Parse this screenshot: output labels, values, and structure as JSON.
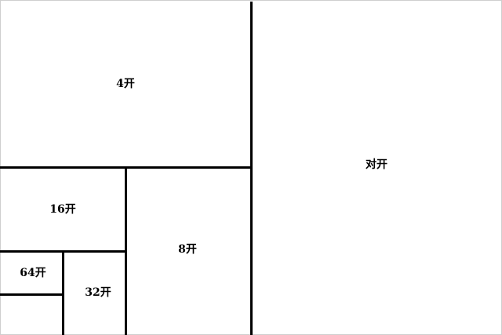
{
  "diagram": {
    "sections": {
      "half": "对开",
      "quarter": "4开",
      "eighth": "8开",
      "sixteenth": "16开",
      "thirty_second": "32开",
      "sixty_fourth": "64开"
    },
    "colors": {
      "line": "#000000",
      "frame": "#cfcfcf",
      "background": "#ffffff"
    }
  }
}
